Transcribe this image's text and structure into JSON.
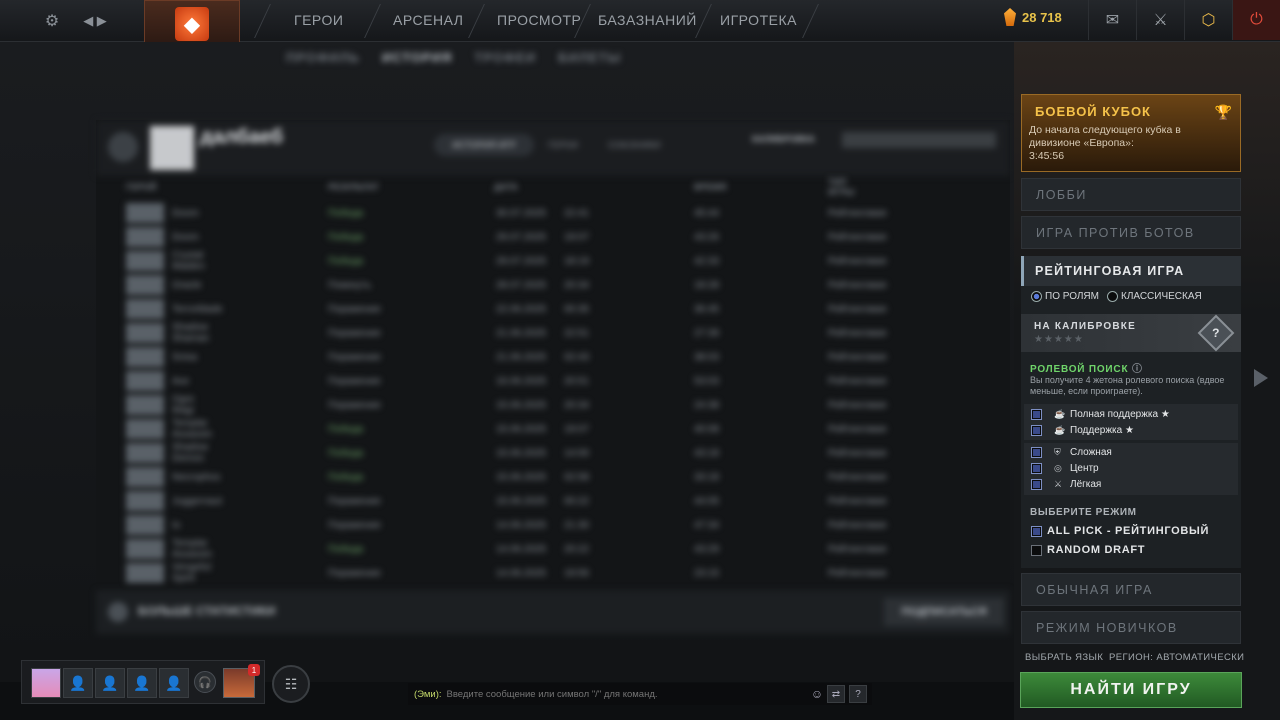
{
  "topbar": {
    "nav": [
      "ГЕРОИ",
      "АРСЕНАЛ",
      "ПРОСМОТР",
      "БАЗАЗНАНИЙ",
      "ИГРОТЕКА"
    ],
    "shards": "28 718"
  },
  "profile": {
    "subtabs": [
      "ПРОФИЛЬ",
      "ИСТОРИЯ",
      "ТРОФЕИ",
      "БИЛЕТЫ"
    ],
    "username": "далбаеб",
    "inner_tabs": [
      "ИСТОРИЯ ИГР",
      "ГЕРОИ",
      "СОЮЗНИКИ"
    ],
    "calibration_label": "КАЛИБРОВКА",
    "columns": [
      "ГЕРОЙ",
      "РЕЗУЛЬТАТ",
      "ДАТА",
      "ВРЕМЯ",
      "ТИП ИГРЫ"
    ],
    "matches": [
      {
        "hero": "Doom",
        "result": "Победа",
        "date": "30.07.2025",
        "time": "22:41",
        "duration": "45:44",
        "type": "Рейтинговая"
      },
      {
        "hero": "Doom",
        "result": "Победа",
        "date": "29.07.2025",
        "time": "19:07",
        "duration": "43:26",
        "type": "Рейтинговая"
      },
      {
        "hero": "Crystal Maiden",
        "result": "Победа",
        "date": "29.07.2025",
        "time": "18:19",
        "duration": "42:33",
        "type": "Рейтинговая"
      },
      {
        "hero": "Oracle",
        "result": "Покинуть",
        "date": "28.07.2025",
        "time": "20:34",
        "duration": "18:28",
        "type": "Рейтинговая"
      },
      {
        "hero": "Terrorblade",
        "result": "Поражение",
        "date": "22.06.2025",
        "time": "00:35",
        "duration": "36:45",
        "type": "Рейтинговая"
      },
      {
        "hero": "Shadow Shaman",
        "result": "Поражение",
        "date": "21.06.2025",
        "time": "22:51",
        "duration": "27:39",
        "type": "Рейтинговая"
      },
      {
        "hero": "Snisa",
        "result": "Поражение",
        "date": "21.06.2025",
        "time": "02:43",
        "duration": "38:03",
        "type": "Рейтинговая"
      },
      {
        "hero": "Axe",
        "result": "Поражение",
        "date": "16.06.2025",
        "time": "20:51",
        "duration": "53:03",
        "type": "Рейтинговая"
      },
      {
        "hero": "Ogre Magi",
        "result": "Поражение",
        "date": "15.06.2025",
        "time": "20:34",
        "duration": "24:38",
        "type": "Рейтинговая"
      },
      {
        "hero": "Templar Assassin",
        "result": "Победа",
        "date": "15.06.2025",
        "time": "19:07",
        "duration": "40:08",
        "type": "Рейтинговая"
      },
      {
        "hero": "Shadow Demon",
        "result": "Победа",
        "date": "15.06.2025",
        "time": "14:00",
        "duration": "43:18",
        "type": "Рейтинговая"
      },
      {
        "hero": "Necrophos",
        "result": "Победа",
        "date": "15.06.2025",
        "time": "02:58",
        "duration": "33:18",
        "type": "Рейтинговая"
      },
      {
        "hero": "Juggernaut",
        "result": "Поражение",
        "date": "15.06.2025",
        "time": "00:22",
        "duration": "44:05",
        "type": "Рейтинговая"
      },
      {
        "hero": "Io",
        "result": "Поражение",
        "date": "14.06.2025",
        "time": "21:30",
        "duration": "47:34",
        "type": "Рейтинговая"
      },
      {
        "hero": "Templar Assassin",
        "result": "Победа",
        "date": "14.06.2025",
        "time": "20:22",
        "duration": "43:29",
        "type": "Рейтинговая"
      },
      {
        "hero": "Vengeful Spirit",
        "result": "Поражение",
        "date": "14.06.2025",
        "time": "19:56",
        "duration": "23:15",
        "type": "Рейтинговая"
      }
    ],
    "more_stats": "БОЛЬШЕ СТАТИСТИКИ",
    "subscribe": "ПОДПИСАТЬСЯ"
  },
  "cup": {
    "title": "БОЕВОЙ КУБОК",
    "desc": "До начала следующего кубка в дивизионе «Европа»:",
    "timer": "3:45:56"
  },
  "menu": {
    "lobby": "ЛОББИ",
    "bots": "ИГРА ПРОТИВ БОТОВ",
    "ranked": "РЕЙТИНГОВАЯ ИГРА",
    "by_roles": "ПО РОЛЯМ",
    "classic": "КЛАССИЧЕСКАЯ",
    "calibration": "НА КАЛИБРОВКЕ",
    "stars": "★★★★★",
    "badge": "?",
    "role_search": "РОЛЕВОЙ ПОИСК",
    "role_desc": "Вы получите 4 жетона ролевого поиска (вдвое меньше, если проиграете).",
    "roles": [
      "Полная поддержка ★",
      "Поддержка ★",
      "Сложная",
      "Центр",
      "Лёгкая"
    ],
    "choose_mode": "ВЫБЕРИТЕ РЕЖИМ",
    "modes": [
      "ALL PICK - РЕЙТИНГОВЫЙ",
      "RANDOM DRAFT"
    ],
    "normal": "ОБЫЧНАЯ ИГРА",
    "newbie": "РЕЖИМ НОВИЧКОВ",
    "language": "ВЫБРАТЬ ЯЗЫК",
    "region": "РЕГИОН: АВТОМАТИЧЕСКИ",
    "find": "НАЙТИ ИГРУ"
  },
  "chat": {
    "who": "(Эми):",
    "placeholder": "Введите сообщение или символ \"/\" для команд."
  },
  "party": {
    "notification": "1"
  }
}
